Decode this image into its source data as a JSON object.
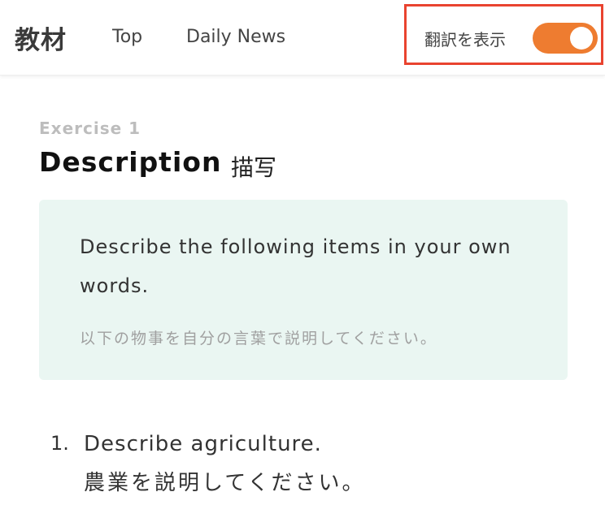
{
  "header": {
    "logo": "教材",
    "nav": [
      {
        "label": "Top"
      },
      {
        "label": "Daily News"
      }
    ],
    "translation_toggle": {
      "label": "翻訳を表示",
      "state": "on",
      "color": "#ee7c30",
      "highlight_color": "#e9432f"
    }
  },
  "exercise": {
    "label": "Exercise 1",
    "title": "Description",
    "title_ja": "描写",
    "instruction": {
      "en": "Describe the following items in your own words.",
      "ja": "以下の物事を自分の言葉で説明してください。",
      "background": "#eaf6f2"
    },
    "questions": [
      {
        "number": "1.",
        "en": "Describe agriculture.",
        "ja": "農業を説明してください。"
      }
    ]
  }
}
